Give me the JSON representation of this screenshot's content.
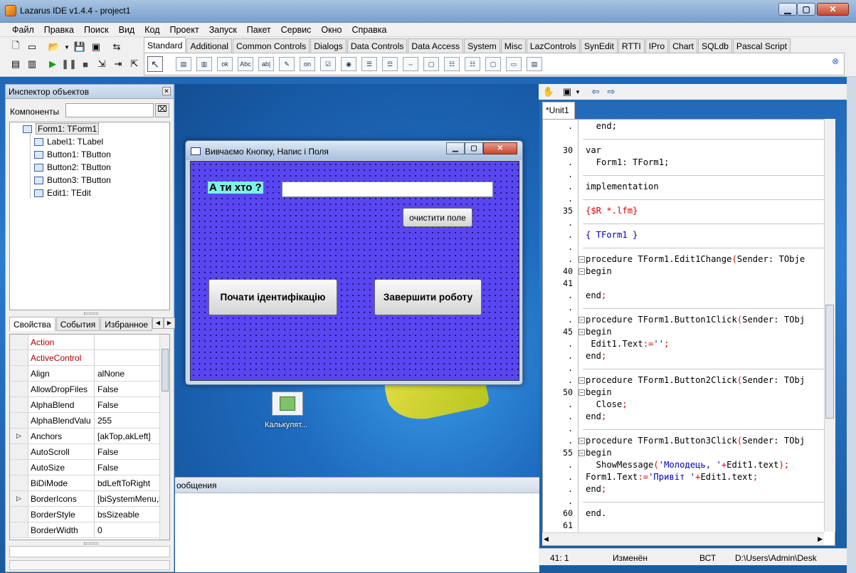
{
  "window": {
    "title": "Lazarus IDE v1.4.4 - project1"
  },
  "menu": [
    "Файл",
    "Правка",
    "Поиск",
    "Вид",
    "Код",
    "Проект",
    "Запуск",
    "Пакет",
    "Сервис",
    "Окно",
    "Справка"
  ],
  "palette_tabs": [
    "Standard",
    "Additional",
    "Common Controls",
    "Dialogs",
    "Data Controls",
    "Data Access",
    "System",
    "Misc",
    "LazControls",
    "SynEdit",
    "RTTI",
    "IPro",
    "Chart",
    "SQLdb",
    "Pascal Script"
  ],
  "palette_icons": [
    "TMainMenu",
    "TPopupMenu",
    "TButton",
    "TLabel",
    "TEdit",
    "TMemo",
    "TToggleBox",
    "TCheckBox",
    "TRadioButton",
    "TListBox",
    "TComboBox",
    "TScrollBar",
    "TGroupBox",
    "TRadioGroup",
    "TCheckGroup",
    "TPanel",
    "TFrame",
    "TActionList"
  ],
  "palette_icon_glyphs": [
    "▤",
    "▥",
    "ok",
    "Abc",
    "ab|",
    "✎",
    "on",
    "☑",
    "◉",
    "☰",
    "☲",
    "⇔",
    "▢",
    "☷",
    "☷",
    "▢",
    "▭",
    "▤"
  ],
  "inspector": {
    "title": "Инспектор объектов",
    "components_label": "Компоненты",
    "tree": [
      {
        "label": "Form1: TForm1",
        "selected": true
      },
      {
        "label": "Label1: TLabel"
      },
      {
        "label": "Button1: TButton"
      },
      {
        "label": "Button2: TButton"
      },
      {
        "label": "Button3: TButton"
      },
      {
        "label": "Edit1: TEdit"
      }
    ],
    "tabs": [
      "Свойства",
      "События",
      "Избранное"
    ],
    "props": [
      {
        "name": "Action",
        "value": "",
        "red": true
      },
      {
        "name": "ActiveControl",
        "value": "",
        "red": true
      },
      {
        "name": "Align",
        "value": "alNone"
      },
      {
        "name": "AllowDropFiles",
        "value": "False"
      },
      {
        "name": "AlphaBlend",
        "value": "False"
      },
      {
        "name": "AlphaBlendValu",
        "value": "255"
      },
      {
        "name": "Anchors",
        "value": "[akTop,akLeft]",
        "expand": true
      },
      {
        "name": "AutoScroll",
        "value": "False"
      },
      {
        "name": "AutoSize",
        "value": "False"
      },
      {
        "name": "BiDiMode",
        "value": "bdLeftToRight"
      },
      {
        "name": "BorderIcons",
        "value": "[biSystemMenu,b",
        "expand": true
      },
      {
        "name": "BorderStyle",
        "value": "bsSizeable"
      },
      {
        "name": "BorderWidth",
        "value": "0"
      }
    ]
  },
  "desktop": {
    "icon_label": "Калькулят..."
  },
  "messages": {
    "title": "ообщения"
  },
  "form": {
    "caption": "Вивчаємо Кнопку, Напис і Поля",
    "label1": "А ти хто ?",
    "edit1_value": "",
    "button3": "очистити поле",
    "button1": "Почати ідентифікацію",
    "button2": "Завершити роботу"
  },
  "editor": {
    "tab": "*Unit1",
    "lines": [
      {
        "ln": ".",
        "code": [
          [
            "kw",
            "  end;"
          ]
        ]
      },
      {
        "ln": "",
        "code": []
      },
      {
        "ln": "30",
        "code": [
          [
            "kw",
            "var"
          ]
        ]
      },
      {
        "ln": ".",
        "code": [
          [
            "kw",
            "  Form1: TForm1;"
          ]
        ]
      },
      {
        "ln": ".",
        "code": []
      },
      {
        "ln": ".",
        "code": [
          [
            "kw",
            "implementation"
          ]
        ]
      },
      {
        "ln": ".",
        "code": []
      },
      {
        "ln": "35",
        "code": [
          [
            "dir",
            "{$R *.lfm}"
          ]
        ]
      },
      {
        "ln": ".",
        "code": []
      },
      {
        "ln": ".",
        "code": [
          [
            "cmt",
            "{ TForm1 }"
          ]
        ]
      },
      {
        "ln": ".",
        "code": []
      },
      {
        "ln": ".",
        "code": [
          [
            "kw",
            "procedure TForm1.Edit1Change"
          ],
          [
            "sym",
            "("
          ],
          [
            "kw",
            "Sender: TObje"
          ]
        ]
      },
      {
        "ln": "40",
        "code": [
          [
            "kw",
            "begin"
          ]
        ]
      },
      {
        "ln": "41",
        "code": []
      },
      {
        "ln": ".",
        "code": [
          [
            "kw",
            "end"
          ],
          [
            "sym",
            ";"
          ]
        ]
      },
      {
        "ln": ".",
        "code": []
      },
      {
        "ln": ".",
        "code": [
          [
            "kw",
            "procedure TForm1.Button1Click"
          ],
          [
            "sym",
            "("
          ],
          [
            "kw",
            "Sender: TObj"
          ]
        ]
      },
      {
        "ln": "45",
        "code": [
          [
            "kw",
            "begin"
          ]
        ]
      },
      {
        "ln": ".",
        "code": [
          [
            "kw",
            " Edit1.Text"
          ],
          [
            "sym",
            ":="
          ],
          [
            "str",
            "''"
          ],
          [
            "sym",
            ";"
          ]
        ]
      },
      {
        "ln": ".",
        "code": [
          [
            "kw",
            "end"
          ],
          [
            "sym",
            ";"
          ]
        ]
      },
      {
        "ln": ".",
        "code": []
      },
      {
        "ln": ".",
        "code": [
          [
            "kw",
            "procedure TForm1.Button2Click"
          ],
          [
            "sym",
            "("
          ],
          [
            "kw",
            "Sender: TObj"
          ]
        ]
      },
      {
        "ln": "50",
        "code": [
          [
            "kw",
            "begin"
          ]
        ]
      },
      {
        "ln": ".",
        "code": [
          [
            "kw",
            "  Close"
          ],
          [
            "sym",
            ";"
          ]
        ]
      },
      {
        "ln": ".",
        "code": [
          [
            "kw",
            "end"
          ],
          [
            "sym",
            ";"
          ]
        ]
      },
      {
        "ln": ".",
        "code": []
      },
      {
        "ln": ".",
        "code": [
          [
            "kw",
            "procedure TForm1.Button3Click"
          ],
          [
            "sym",
            "("
          ],
          [
            "kw",
            "Sender: TObj"
          ]
        ]
      },
      {
        "ln": "55",
        "code": [
          [
            "kw",
            "begin"
          ]
        ]
      },
      {
        "ln": ".",
        "code": [
          [
            "kw",
            "  ShowMessage"
          ],
          [
            "sym",
            "("
          ],
          [
            "str",
            "'Молодець, '"
          ],
          [
            "sym",
            "+"
          ],
          [
            "kw",
            "Edit1.text"
          ],
          [
            "sym",
            ");"
          ]
        ]
      },
      {
        "ln": ".",
        "code": [
          [
            "kw",
            "Form1.Text"
          ],
          [
            "sym",
            ":="
          ],
          [
            "str",
            "'Привіт '"
          ],
          [
            "sym",
            "+"
          ],
          [
            "kw",
            "Edit1.text"
          ],
          [
            "sym",
            ";"
          ]
        ]
      },
      {
        "ln": ".",
        "code": [
          [
            "kw",
            "end"
          ],
          [
            "sym",
            ";"
          ]
        ]
      },
      {
        "ln": ".",
        "code": []
      },
      {
        "ln": "60",
        "code": [
          [
            "kw",
            "end."
          ]
        ]
      },
      {
        "ln": "61",
        "code": []
      }
    ]
  },
  "status": {
    "pos": "41:  1",
    "state": "Изменён",
    "mode": "ВСТ",
    "path": "D:\\Users\\Admin\\Desk"
  }
}
